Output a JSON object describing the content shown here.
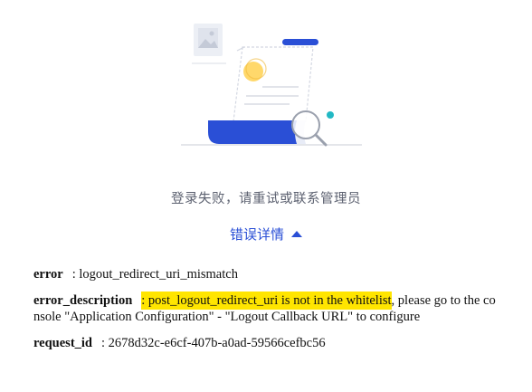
{
  "status": {
    "message": "登录失败，请重试或联系管理员",
    "details_toggle_label": "错误详情"
  },
  "error_details": {
    "error": {
      "key": "error",
      "value": ": logout_redirect_uri_mismatch"
    },
    "error_description": {
      "key": "error_description",
      "value_highlight": ": post_logout_redirect_uri is not in the whitelist",
      "value_rest": ", please go to the console \"Application Configuration\" - \"Logout Callback URL\" to configure"
    },
    "request_id": {
      "key": "request_id",
      "value": ": 2678d32c-e6cf-407b-a0ad-59566cefbc56"
    }
  },
  "colors": {
    "accent": "#2a4fd6",
    "highlight": "#ffe500",
    "teal_dot": "#22b8c4",
    "yellow_circle": "#ffd86b",
    "muted_text": "#5c6170"
  },
  "icons": [
    "image-placeholder-icon",
    "document-illustration",
    "magnifier-icon",
    "caret-up-icon"
  ]
}
